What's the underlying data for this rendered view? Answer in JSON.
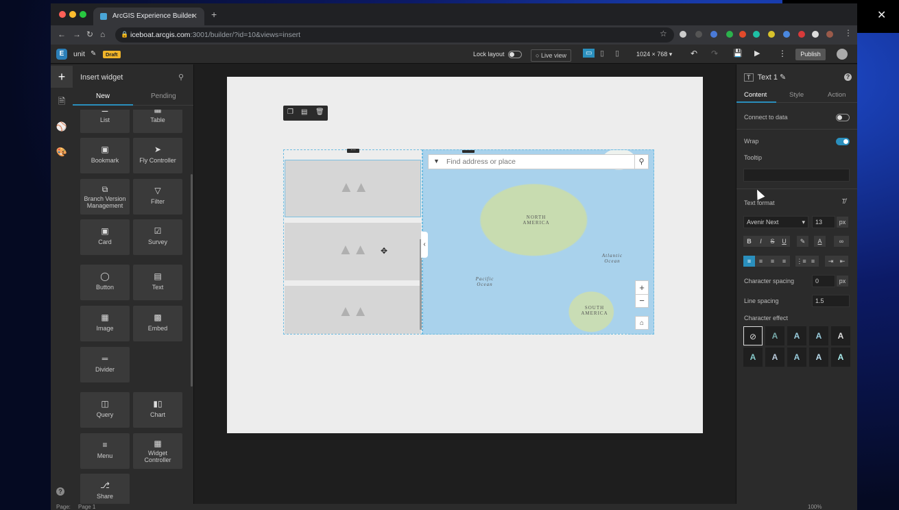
{
  "browser": {
    "tab_title": "ArcGIS Experience Builder",
    "url_host": "iceboat.arcgis.com",
    "url_path": ":3001/builder/?id=10&views=insert"
  },
  "app": {
    "project_name": "unit",
    "badge": "Draft",
    "lock_layout": "Lock layout",
    "live_view": "Live view",
    "resolution": "1024 × 768",
    "publish": "Publish"
  },
  "insert_panel": {
    "title": "Insert widget",
    "tabs": [
      "New",
      "Pending"
    ],
    "widgets": [
      {
        "label": "List",
        "icon": "list-icon"
      },
      {
        "label": "Table",
        "icon": "table-icon"
      },
      {
        "label": "Bookmark",
        "icon": "bookmark-icon"
      },
      {
        "label": "Fly Controller",
        "icon": "plane-icon"
      },
      {
        "label": "Branch Version Management",
        "icon": "branch-icon"
      },
      {
        "label": "Filter",
        "icon": "filter-icon"
      },
      {
        "label": "Card",
        "icon": "card-icon"
      },
      {
        "label": "Survey",
        "icon": "survey-icon"
      },
      {
        "label": "Button",
        "icon": "button-icon"
      },
      {
        "label": "Text",
        "icon": "text-icon"
      },
      {
        "label": "Image",
        "icon": "image-icon"
      },
      {
        "label": "Embed",
        "icon": "embed-icon"
      },
      {
        "label": "Divider",
        "icon": "divider-icon"
      },
      {
        "label": "Query",
        "icon": "query-icon"
      },
      {
        "label": "Chart",
        "icon": "chart-icon"
      },
      {
        "label": "Menu",
        "icon": "menu-icon"
      },
      {
        "label": "Widget Controller",
        "icon": "widget-controller-icon"
      },
      {
        "label": "Share",
        "icon": "share-icon"
      }
    ]
  },
  "map": {
    "search_placeholder": "Find address or place",
    "labels": {
      "north_america": "NORTH AMERICA",
      "south_america": "SOUTH AMERICA",
      "atlantic": "Atlantic Ocean",
      "pacific": "Pacific Ocean"
    }
  },
  "settings": {
    "widget_name": "Text 1",
    "tabs": [
      "Content",
      "Style",
      "Action"
    ],
    "connect_to_data": "Connect to data",
    "wrap": "Wrap",
    "tooltip": "Tooltip",
    "text_format": "Text format",
    "font": "Avenir Next",
    "font_size": "13",
    "unit": "px",
    "character_spacing": "Character spacing",
    "char_spacing_value": "0",
    "line_spacing": "Line spacing",
    "line_spacing_value": "1.5",
    "character_effect": "Character effect"
  },
  "status": {
    "page_label": "Page:",
    "page_value": "Page 1",
    "zoom": "100%"
  }
}
